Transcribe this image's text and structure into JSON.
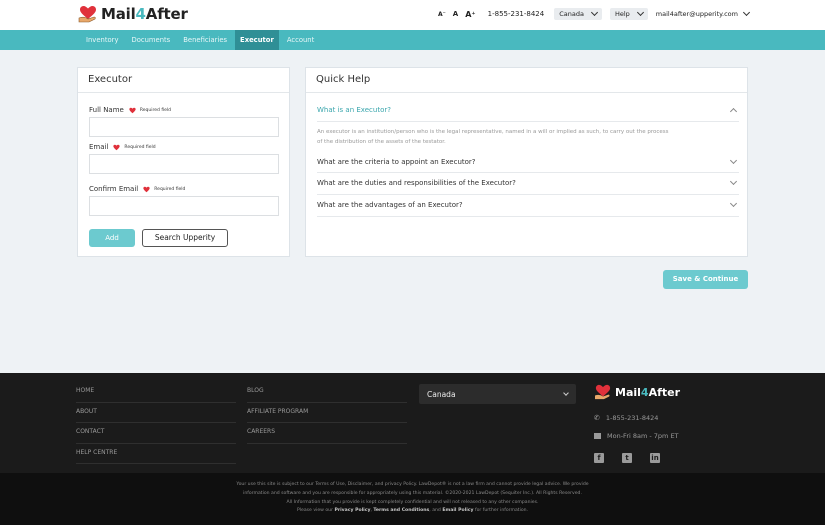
{
  "brand": {
    "name_part1": "Mail",
    "name_four": "4",
    "name_part2": "After"
  },
  "header": {
    "font_small": "A⁻",
    "font_medium": "A",
    "font_large": "A⁺",
    "phone": "1-855-231-8424",
    "country": "Canada",
    "help": "Help",
    "email": "mail4after@upperity.com"
  },
  "nav": {
    "items": [
      {
        "label": "Inventory"
      },
      {
        "label": "Documents"
      },
      {
        "label": "Beneficiaries"
      },
      {
        "label": "Executor"
      },
      {
        "label": "Account"
      }
    ],
    "active": "Executor"
  },
  "executor_form": {
    "title": "Executor",
    "required_text": "Required field",
    "full_name_label": "Full Name",
    "full_name_value": "",
    "email_label": "Email",
    "email_value": "",
    "confirm_email_label": "Confirm Email",
    "confirm_email_value": "",
    "add_button": "Add",
    "search_button": "Search Upperity"
  },
  "quick_help": {
    "title": "Quick Help",
    "questions": [
      {
        "q": "What is an Executor?",
        "open": true
      },
      {
        "q": "What are the criteria to appoint an Executor?",
        "open": false
      },
      {
        "q": "What are the duties and responsibilities of the Executor?",
        "open": false
      },
      {
        "q": "What are the advantages of an Executor?",
        "open": false
      }
    ],
    "answer_line1": "An executor is an institution/person who is the legal representative, named in a will or implied as such, to carry out the process",
    "answer_line2": "of the distribution of the assets of the testator."
  },
  "save_button": "Save & Continue",
  "footer": {
    "col1": [
      "HOME",
      "ABOUT",
      "CONTACT",
      "HELP CENTRE"
    ],
    "col2": [
      "BLOG",
      "AFFILIATE PROGRAM",
      "CAREERS"
    ],
    "country": "Canada",
    "phone": "1-855-231-8424",
    "hours": "Mon-Fri 8am - 7pm ET",
    "social": [
      "facebook-icon",
      "twitter-icon",
      "linkedin-icon"
    ],
    "legal_line1": "Your use this site is subject to our Terms of Use, Disclaimer, and privacy Policy. LawDepot® is not a law firm and cannot provide legal advice. We provide",
    "legal_line2": "information and software and you are responsible for appropriately using this material. ©2020-2021 LawDepot (Sequiter Inc.). All Rights Reserved.",
    "legal_line3": "All Information that you provide is kept completely confidential and will not released to any other companies.",
    "legal_line4_pre": "Please view our",
    "legal_privacy": "Privacy Policy",
    "legal_comma": ",",
    "legal_terms": "Terms and Conditions",
    "legal_and": ", and",
    "legal_email": "Email Policy",
    "legal_post": "for further information."
  },
  "colors": {
    "accent": "#49b9bf",
    "button": "#6ccacf",
    "nav_active": "#2f8f96",
    "heart": "#e0313b"
  }
}
